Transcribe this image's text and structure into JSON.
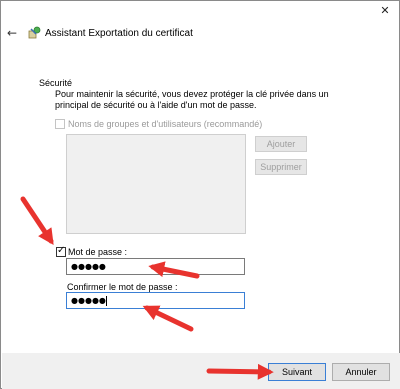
{
  "window": {
    "title": "Assistant Exportation du certificat",
    "close_glyph": "✕",
    "back_glyph": "←"
  },
  "security": {
    "section_label": "Sécurité",
    "description": "Pour maintenir la sécurité, vous devez protéger la clé privée dans un principal de sécurité ou à l'aide d'un mot de passe.",
    "groups_checkbox_label": "Noms de groupes et d'utilisateurs (recommandé)",
    "groups_checked": false,
    "add_label": "Ajouter",
    "remove_label": "Supprimer",
    "password_checkbox_label": "Mot de passe :",
    "password_checked": true,
    "password_value": "●●●●●",
    "confirm_label": "Confirmer le mot de passe :",
    "confirm_value": "●●●●●"
  },
  "footer": {
    "next_label": "Suivant",
    "cancel_label": "Annuler"
  },
  "colors": {
    "annotation_arrow": "#e8332e",
    "focus_border": "#3a7fd5",
    "footer_bg": "#f0f0f0"
  },
  "icons": {
    "wizard": "certificate-wizard-icon",
    "back": "back-arrow-icon",
    "close": "close-icon"
  }
}
